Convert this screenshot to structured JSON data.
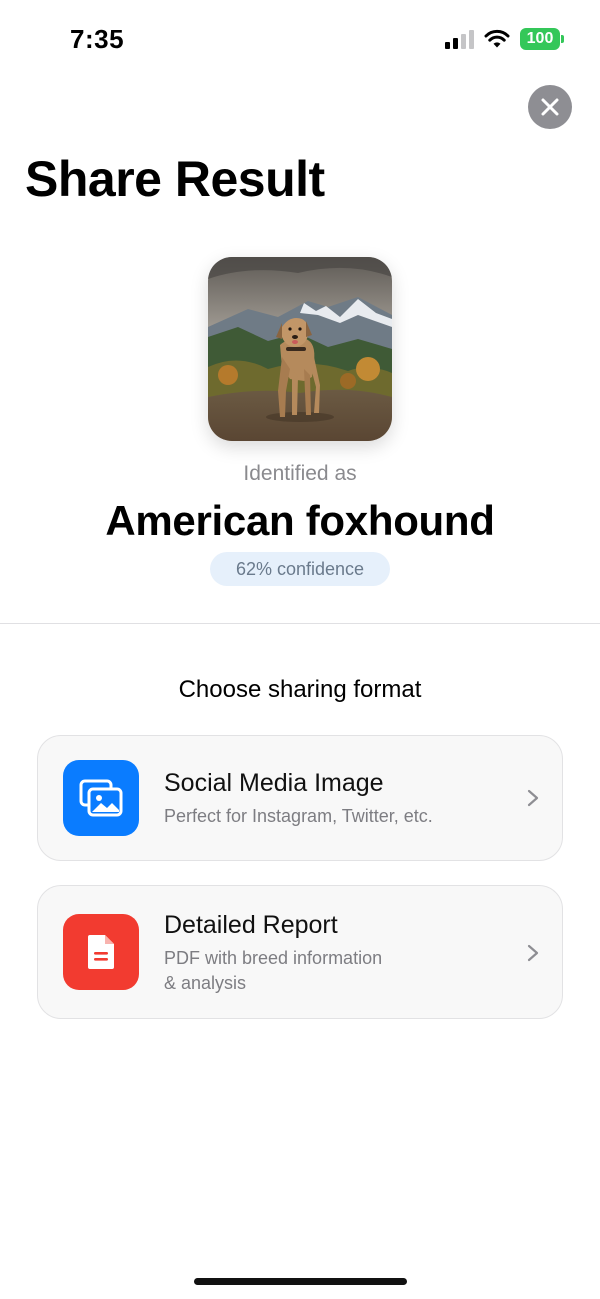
{
  "status_bar": {
    "time": "7:35",
    "battery": "100"
  },
  "header": {
    "title": "Share Result"
  },
  "result": {
    "identified_label": "Identified as",
    "breed": "American foxhound",
    "confidence": "62% confidence"
  },
  "sharing": {
    "heading": "Choose sharing format",
    "options": [
      {
        "title": "Social Media Image",
        "description": "Perfect for Instagram, Twitter, etc.",
        "icon": "photos-icon",
        "color": "#0a7cff"
      },
      {
        "title": "Detailed Report",
        "description_line1": "PDF with breed information",
        "description_line2": "& analysis",
        "icon": "document-icon",
        "color": "#f23b30"
      }
    ]
  }
}
